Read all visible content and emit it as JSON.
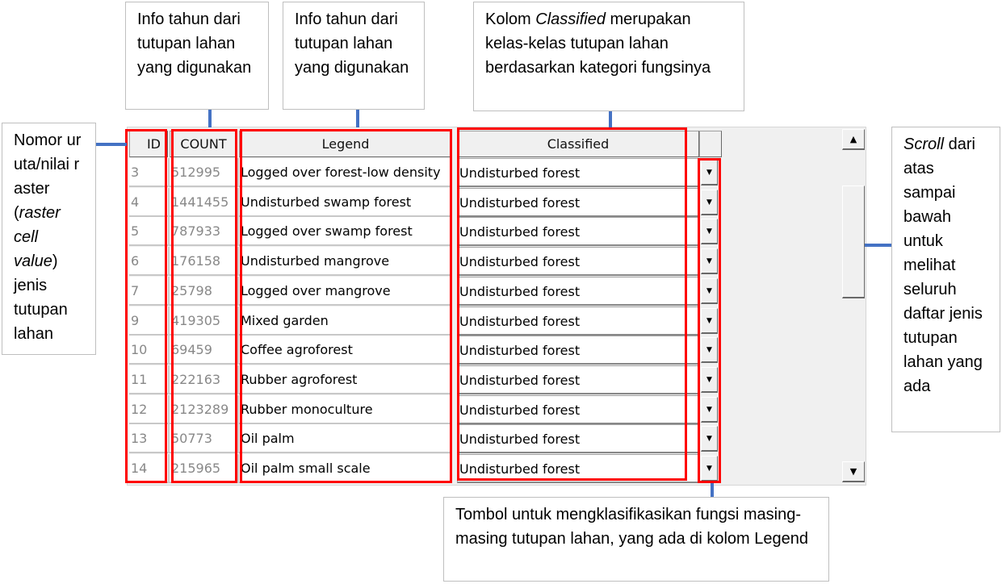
{
  "annotations": {
    "year_info_1": "Info tahun dari tutupan lahan yang digunakan",
    "year_info_2": "Info tahun dari tutupan lahan yang digunakan",
    "classified_pre": "Kolom ",
    "classified_em": "Classified",
    "classified_post": "  merupakan kelas-kelas tutupan lahan berdasarkan kategori fungsinya",
    "id_a": "Nomor uruta/nilai raster (",
    "id_em": "raster cell value",
    "id_b": ") jenis tutupan lahan",
    "scroll_em": "Scroll",
    "scroll_post": " dari atas sampai bawah untuk melihat seluruh daftar jenis tutupan lahan yang ada",
    "button_info": "Tombol untuk mengklasifikasikan fungsi masing-masing tutupan lahan, yang ada di kolom Legend"
  },
  "colors": {
    "highlight": "#ff0000",
    "connector": "#4472C4"
  },
  "table": {
    "headers": {
      "id": "ID",
      "count": "COUNT",
      "legend": "Legend",
      "classified": "Classified"
    },
    "rows": [
      {
        "id": "3",
        "count": "512995",
        "legend": "Logged over forest-low density",
        "classified": "Undisturbed forest"
      },
      {
        "id": "4",
        "count": "1441455",
        "legend": "Undisturbed swamp forest",
        "classified": "Undisturbed forest"
      },
      {
        "id": "5",
        "count": "787933",
        "legend": "Logged over swamp forest",
        "classified": "Undisturbed forest"
      },
      {
        "id": "6",
        "count": "176158",
        "legend": "Undisturbed mangrove",
        "classified": "Undisturbed forest"
      },
      {
        "id": "7",
        "count": "25798",
        "legend": "Logged over mangrove",
        "classified": "Undisturbed forest"
      },
      {
        "id": "9",
        "count": "419305",
        "legend": "Mixed garden",
        "classified": "Undisturbed forest"
      },
      {
        "id": "10",
        "count": "69459",
        "legend": "Coffee agroforest",
        "classified": "Undisturbed forest"
      },
      {
        "id": "11",
        "count": "222163",
        "legend": "Rubber agroforest",
        "classified": "Undisturbed forest"
      },
      {
        "id": "12",
        "count": "2123289",
        "legend": "Rubber monoculture",
        "classified": "Undisturbed forest"
      },
      {
        "id": "13",
        "count": "50773",
        "legend": "Oil palm",
        "classified": "Undisturbed forest"
      },
      {
        "id": "14",
        "count": "215965",
        "legend": "Oil palm small scale",
        "classified": "Undisturbed forest"
      }
    ]
  }
}
